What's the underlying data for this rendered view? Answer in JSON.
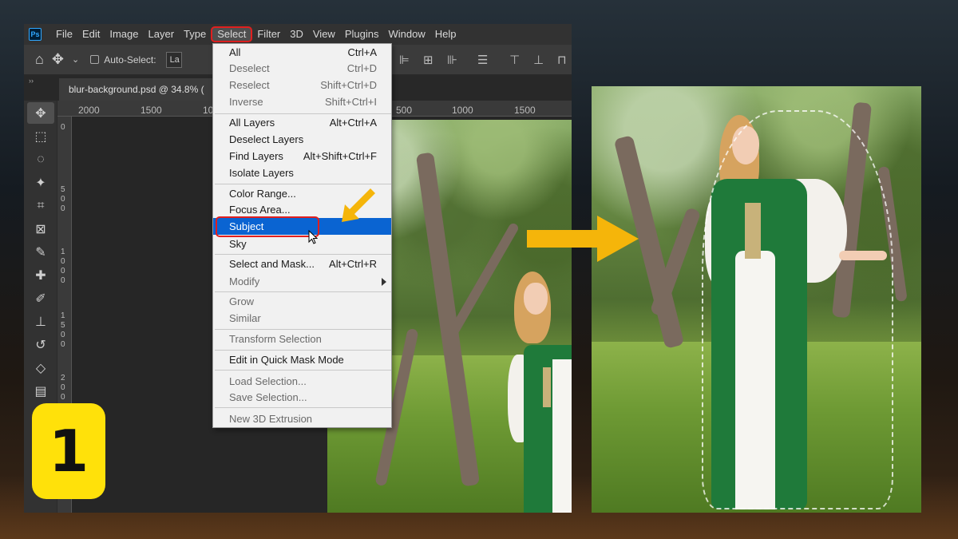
{
  "menubar": {
    "logo": "Ps",
    "items": [
      "File",
      "Edit",
      "Image",
      "Layer",
      "Type",
      "Select",
      "Filter",
      "3D",
      "View",
      "Plugins",
      "Window",
      "Help"
    ],
    "active": "Select"
  },
  "options": {
    "home_icon": "home-icon",
    "move_icon": "move-icon",
    "auto_select_label": "Auto-Select:",
    "layer_select_value": "La"
  },
  "document": {
    "tab_title": "blur-background.psd @ 34.8% ("
  },
  "rulers": {
    "top": [
      "2000",
      "1500",
      "10",
      "500",
      "1000",
      "1500"
    ],
    "left": [
      "0",
      "500",
      "1000",
      "1500",
      "2000"
    ]
  },
  "select_menu": {
    "items": [
      {
        "label": "All",
        "shortcut": "Ctrl+A",
        "state": "normal"
      },
      {
        "label": "Deselect",
        "shortcut": "Ctrl+D",
        "state": "disabled"
      },
      {
        "label": "Reselect",
        "shortcut": "Shift+Ctrl+D",
        "state": "disabled"
      },
      {
        "label": "Inverse",
        "shortcut": "Shift+Ctrl+I",
        "state": "disabled"
      },
      {
        "label": "All Layers",
        "shortcut": "Alt+Ctrl+A",
        "state": "normal"
      },
      {
        "label": "Deselect Layers",
        "shortcut": "",
        "state": "normal"
      },
      {
        "label": "Find Layers",
        "shortcut": "Alt+Shift+Ctrl+F",
        "state": "normal"
      },
      {
        "label": "Isolate Layers",
        "shortcut": "",
        "state": "normal"
      },
      {
        "label": "Color Range...",
        "shortcut": "",
        "state": "normal"
      },
      {
        "label": "Focus Area...",
        "shortcut": "",
        "state": "normal"
      },
      {
        "label": "Subject",
        "shortcut": "",
        "state": "highlight"
      },
      {
        "label": "Sky",
        "shortcut": "",
        "state": "normal"
      },
      {
        "label": "Select and Mask...",
        "shortcut": "Alt+Ctrl+R",
        "state": "normal"
      },
      {
        "label": "Modify",
        "shortcut": "",
        "state": "disabled"
      },
      {
        "label": "Grow",
        "shortcut": "",
        "state": "disabled"
      },
      {
        "label": "Similar",
        "shortcut": "",
        "state": "disabled"
      },
      {
        "label": "Transform Selection",
        "shortcut": "",
        "state": "disabled"
      },
      {
        "label": "Edit in Quick Mask Mode",
        "shortcut": "",
        "state": "normal"
      },
      {
        "label": "Load Selection...",
        "shortcut": "",
        "state": "disabled"
      },
      {
        "label": "Save Selection...",
        "shortcut": "",
        "state": "disabled"
      },
      {
        "label": "New 3D Extrusion",
        "shortcut": "",
        "state": "disabled"
      }
    ]
  },
  "badge": {
    "step": "1"
  },
  "colors": {
    "highlight": "#0a64d2",
    "callout_red": "#e01f1f",
    "arrow_yellow": "#f5b50a",
    "badge_yellow": "#ffe10a",
    "dress_green": "#1f7a3a"
  }
}
